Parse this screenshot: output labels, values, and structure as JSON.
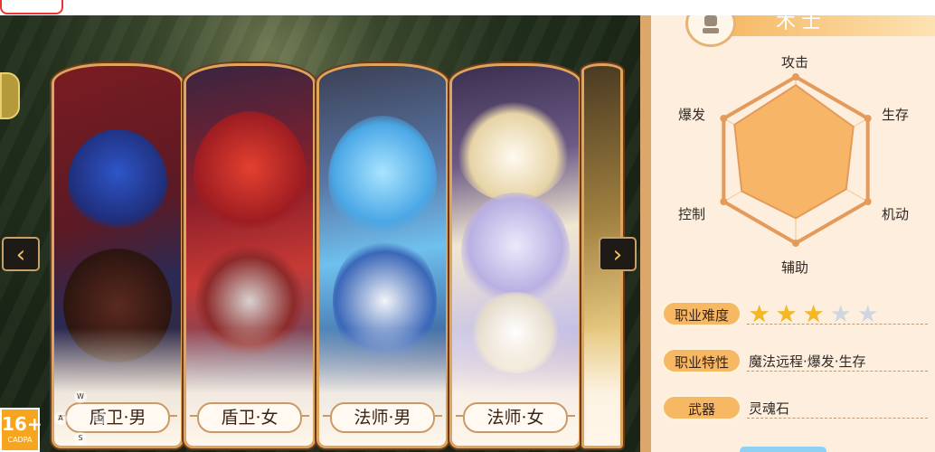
{
  "age_rating": {
    "number": "16+",
    "tag": "CADPA"
  },
  "nav": {
    "left_glyph": "‹",
    "right_glyph": "›"
  },
  "classes": [
    {
      "label": "盾卫·男"
    },
    {
      "label": "盾卫·女"
    },
    {
      "label": "法师·男"
    },
    {
      "label": "法师·女"
    }
  ],
  "keypad": {
    "w": "W",
    "a": "A",
    "d": "D",
    "s": "S"
  },
  "panel": {
    "title": "术士",
    "radar": {
      "axes": [
        "攻击",
        "生存",
        "机动",
        "辅助",
        "控制",
        "爆发"
      ],
      "values": [
        0.9,
        0.8,
        0.7,
        0.7,
        0.75,
        0.85
      ],
      "fill_color": "#f7b567",
      "grid_color": "#e39a5a"
    },
    "difficulty": {
      "label": "职业难度",
      "rating": 3,
      "max": 5
    },
    "traits": {
      "label": "职业特性",
      "value": "魔法远程·爆发·生存"
    },
    "weapon": {
      "label": "武器",
      "value": "灵魂石"
    }
  },
  "colors": {
    "accent": "#f6b863",
    "panel_bg": "#fdeedd",
    "frame": "#dca76a"
  }
}
